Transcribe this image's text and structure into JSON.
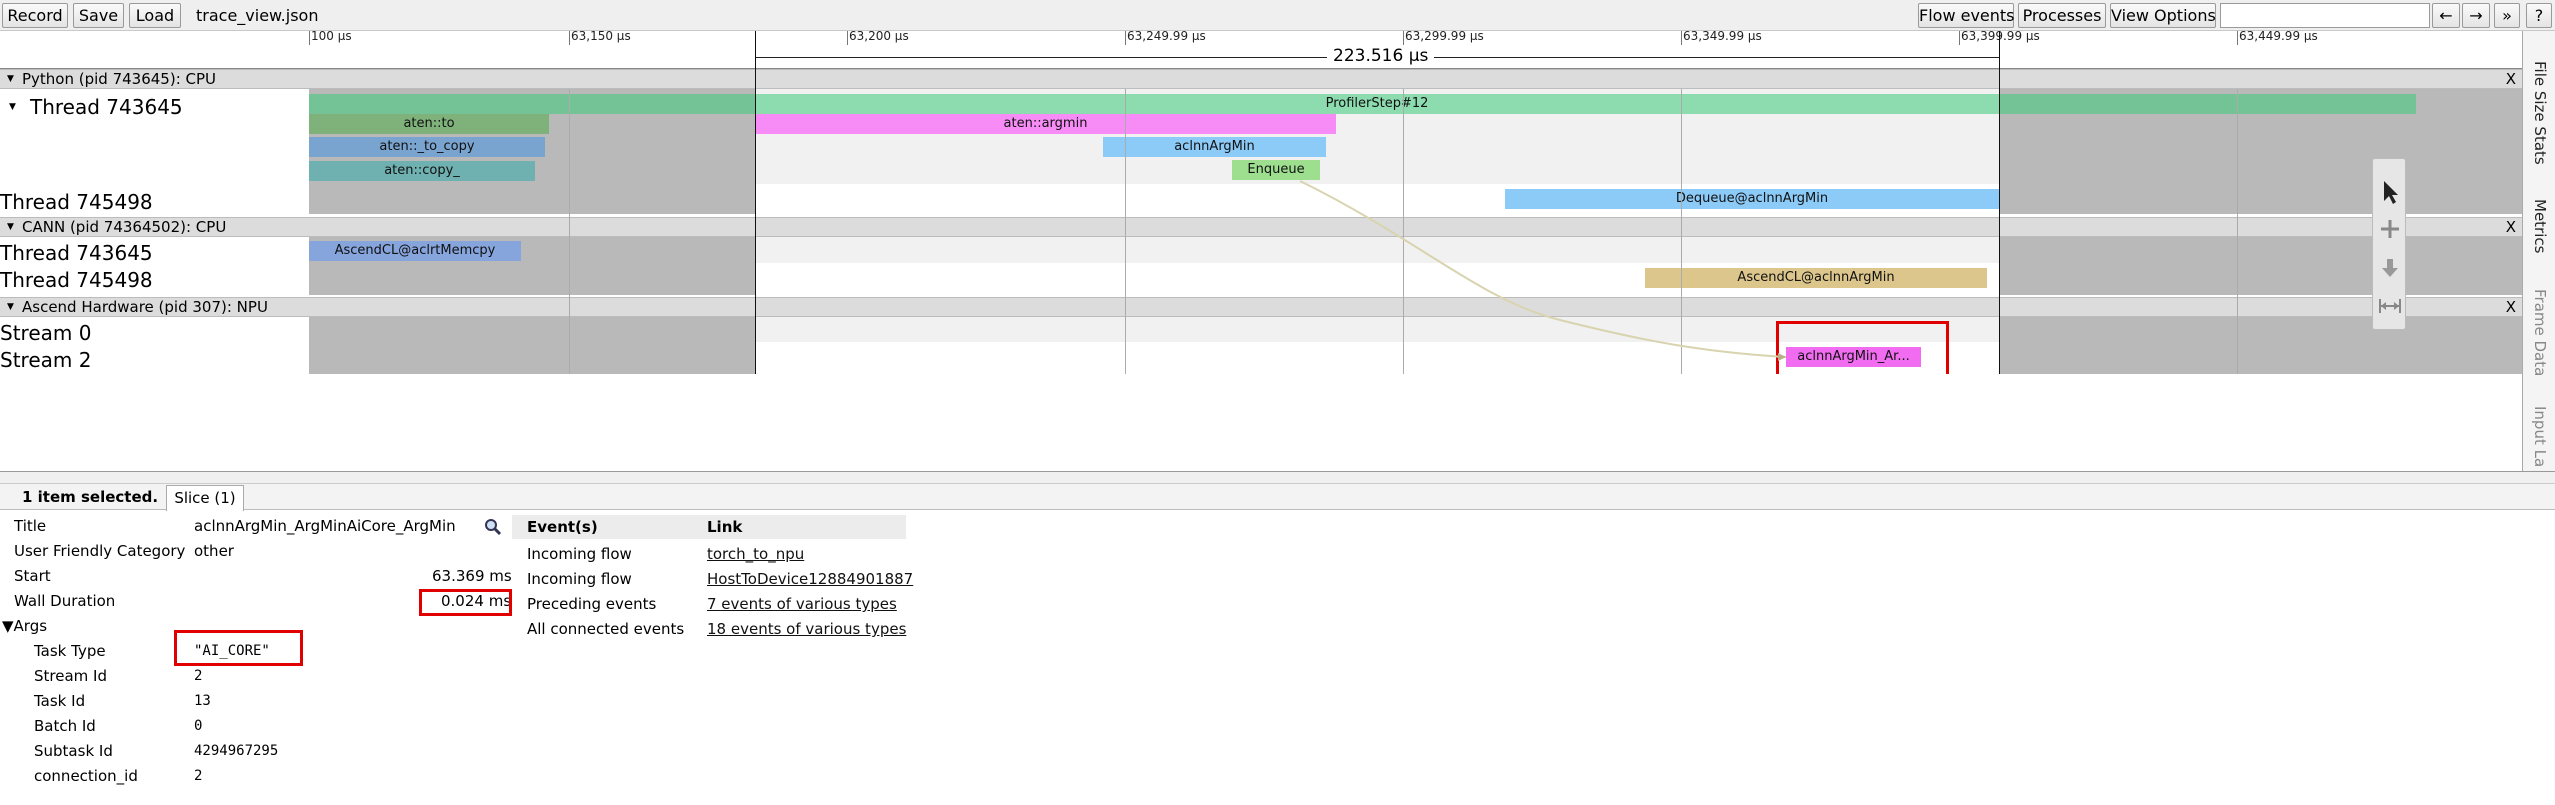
{
  "toolbar": {
    "record": "Record",
    "save": "Save",
    "load": "Load",
    "filename": "trace_view.json",
    "flow_events": "Flow events",
    "processes": "Processes",
    "view_options": "View Options",
    "nav_left": "←",
    "nav_right": "→",
    "more": "»",
    "help": "?"
  },
  "ruler": {
    "ticks": [
      "100 µs",
      "63,150 µs",
      "63,200 µs",
      "63,249.99 µs",
      "63,299.99 µs",
      "63,349.99 µs",
      "63,399.99 µs",
      "63,449.99 µs"
    ],
    "range_label": "223.516 µs"
  },
  "processes": [
    {
      "label": "Python (pid 743645): CPU",
      "close": "X"
    },
    {
      "label": "CANN (pid 74364502): CPU",
      "close": "X"
    },
    {
      "label": "Ascend Hardware (pid 307): NPU",
      "close": "X"
    }
  ],
  "threads": {
    "python_t1": "Thread 743645",
    "python_t2": "Thread 745498",
    "cann_t1": "Thread 743645",
    "cann_t2": "Thread 745498",
    "stream0": "Stream 0",
    "stream2": "Stream 2"
  },
  "slices": {
    "profiler_step": "ProfilerStep#12",
    "aten_to": "aten::to",
    "aten_to_copy": "aten::_to_copy",
    "aten_copy": "aten::copy_",
    "aten_argmin": "aten::argmin",
    "aclnn_argmin": "aclnnArgMin",
    "enqueue": "Enqueue",
    "dequeue": "Dequeue@aclnnArgMin",
    "acl_memcpy": "AscendCL@aclrtMemcpy",
    "acl_argmin": "AscendCL@aclnnArgMin",
    "npu_kernel": "aclnnArgMin_Ar..."
  },
  "colors": {
    "profiler_step": "#8cdcb0",
    "aten_to": "#7fb27a",
    "aten_to_copy": "#7aa4d0",
    "aten_copy": "#6fb0b0",
    "magenta": "#f78cf7",
    "light_blue": "#8ccaf7",
    "enqueue": "#9ddf8e",
    "acl_memcpy": "#86a5dd",
    "acl_argmin": "#dcc68c",
    "npu_kernel": "#f26cf2",
    "highlight": "#e00000"
  },
  "sidebar": [
    "File Size Stats",
    "Metrics",
    "Frame Data",
    "Input La"
  ],
  "tool_icons": [
    "selection-cursor-icon",
    "pan-cross-icon",
    "zoom-arrow-icon",
    "timing-icon"
  ],
  "panel": {
    "selected_text": "1 item selected.",
    "tab_slice": "Slice (1)",
    "fields": [
      {
        "label": "Title",
        "value": "aclnnArgMin_ArgMinAiCore_ArgMin"
      },
      {
        "label": "User Friendly Category",
        "value": "other"
      },
      {
        "label": "Start",
        "value": "63.369 ms"
      },
      {
        "label": "Wall Duration",
        "value": "0.024 ms"
      }
    ],
    "args_header": "▼Args",
    "args": [
      {
        "label": "Task Type",
        "value": "\"AI_CORE\""
      },
      {
        "label": "Stream Id",
        "value": "2"
      },
      {
        "label": "Task Id",
        "value": "13"
      },
      {
        "label": "Batch Id",
        "value": "0"
      },
      {
        "label": "Subtask Id",
        "value": "4294967295"
      },
      {
        "label": "connection_id",
        "value": "2"
      }
    ],
    "events_header": "Event(s)",
    "link_header": "Link",
    "events": [
      {
        "event": "Incoming flow",
        "link": "torch_to_npu"
      },
      {
        "event": "Incoming flow",
        "link": "HostToDevice12884901887"
      },
      {
        "event": "Preceding events",
        "link": "7 events of various types"
      },
      {
        "event": "All connected events",
        "link": "18 events of various types"
      }
    ]
  }
}
